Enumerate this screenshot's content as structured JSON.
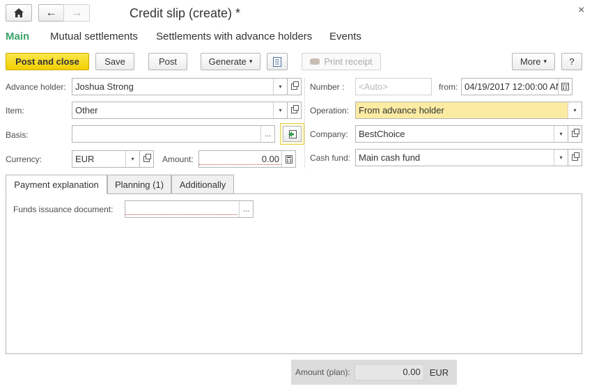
{
  "window": {
    "title": "Credit slip (create) *",
    "close_glyph": "×"
  },
  "nav": {
    "home_icon": "home-icon",
    "back_glyph": "←",
    "forward_glyph": "→"
  },
  "sections": {
    "main": "Main",
    "mutual": "Mutual settlements",
    "advance": "Settlements with advance holders",
    "events": "Events"
  },
  "toolbar": {
    "post_close": "Post and close",
    "save": "Save",
    "post": "Post",
    "generate": "Generate",
    "print_receipt": "Print receipt",
    "more": "More",
    "help": "?",
    "dropdown_glyph": "▾"
  },
  "form": {
    "advance_holder": {
      "label": "Advance holder:",
      "value": "Joshua Strong"
    },
    "item": {
      "label": "Item:",
      "value": "Other"
    },
    "basis": {
      "label": "Basis:",
      "value": ""
    },
    "currency": {
      "label": "Currency:",
      "value": "EUR"
    },
    "amount": {
      "label": "Amount:",
      "value": "0.00"
    },
    "number": {
      "label": "Number :",
      "placeholder": "<Auto>"
    },
    "from": {
      "label": "from:",
      "value": "04/19/2017 12:00:00 AM"
    },
    "operation": {
      "label": "Operation:",
      "value": "From advance holder"
    },
    "company": {
      "label": "Company:",
      "value": "BestChoice"
    },
    "cash_fund": {
      "label": "Cash fund:",
      "value": "Main cash fund"
    },
    "ellipsis": "..."
  },
  "tabs": {
    "payment": "Payment explanation",
    "planning": "Planning (1)",
    "additionally": "Additionally"
  },
  "payment": {
    "funds_label": "Funds issuance document:",
    "funds_value": ""
  },
  "footer": {
    "label": "Amount (plan):",
    "value": "0.00",
    "currency": "EUR"
  },
  "colors": {
    "accent_green": "#3ba36a",
    "primary_yellow": "#f5d800",
    "operation_highlight": "#fbeba3"
  }
}
